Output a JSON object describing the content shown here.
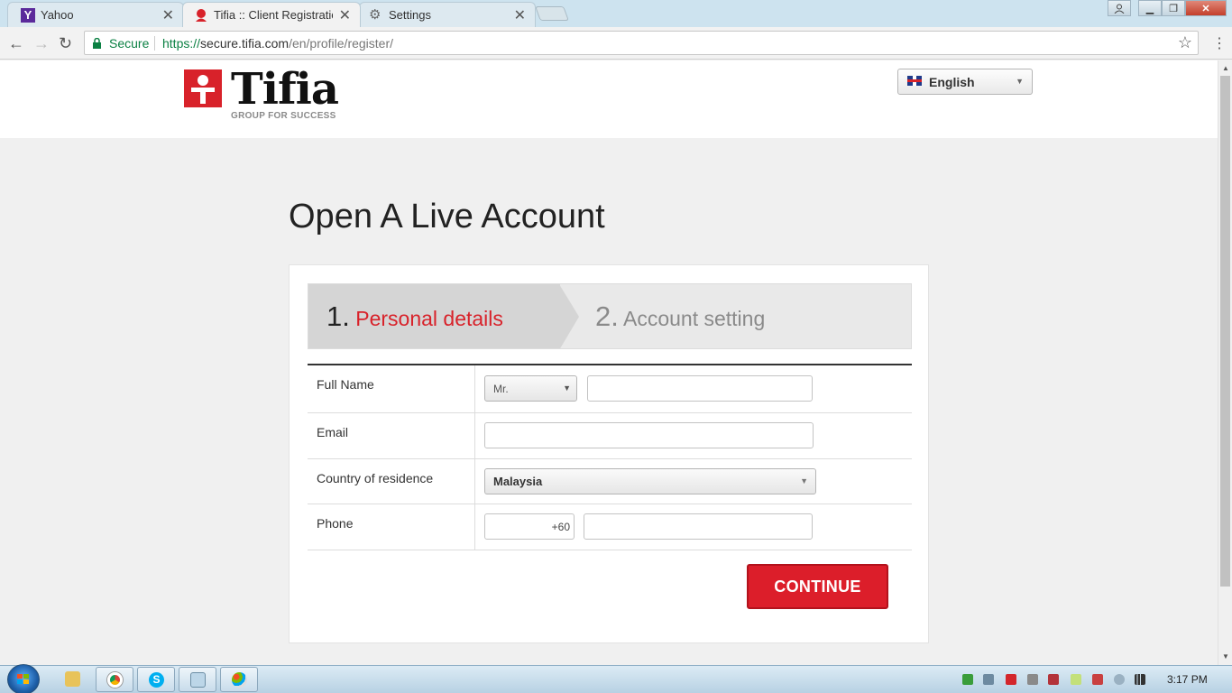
{
  "browser": {
    "tabs": [
      {
        "label": "Yahoo",
        "active": false
      },
      {
        "label": "Tifia :: Client Registration",
        "active": true
      },
      {
        "label": "Settings",
        "active": false
      }
    ],
    "secure_label": "Secure",
    "url_scheme": "https://",
    "url_host": "secure.tifia.com",
    "url_path": "/en/profile/register/"
  },
  "site": {
    "brand": "Tifia",
    "tagline": "GROUP FOR SUCCESS",
    "language": "English",
    "brand_color": "#d8222a"
  },
  "page": {
    "title": "Open A Live Account",
    "steps": [
      {
        "number": "1.",
        "label": "Personal details",
        "active": true
      },
      {
        "number": "2.",
        "label": "Account setting",
        "active": false
      }
    ],
    "form": {
      "full_name_label": "Full Name",
      "salutation": "Mr.",
      "full_name_value": "",
      "email_label": "Email",
      "email_value": "",
      "country_label": "Country of residence",
      "country_value": "Malaysia",
      "phone_label": "Phone",
      "phone_code": "+60",
      "phone_value": ""
    },
    "continue_label": "CONTINUE"
  },
  "taskbar": {
    "clock": "3:17 PM"
  }
}
